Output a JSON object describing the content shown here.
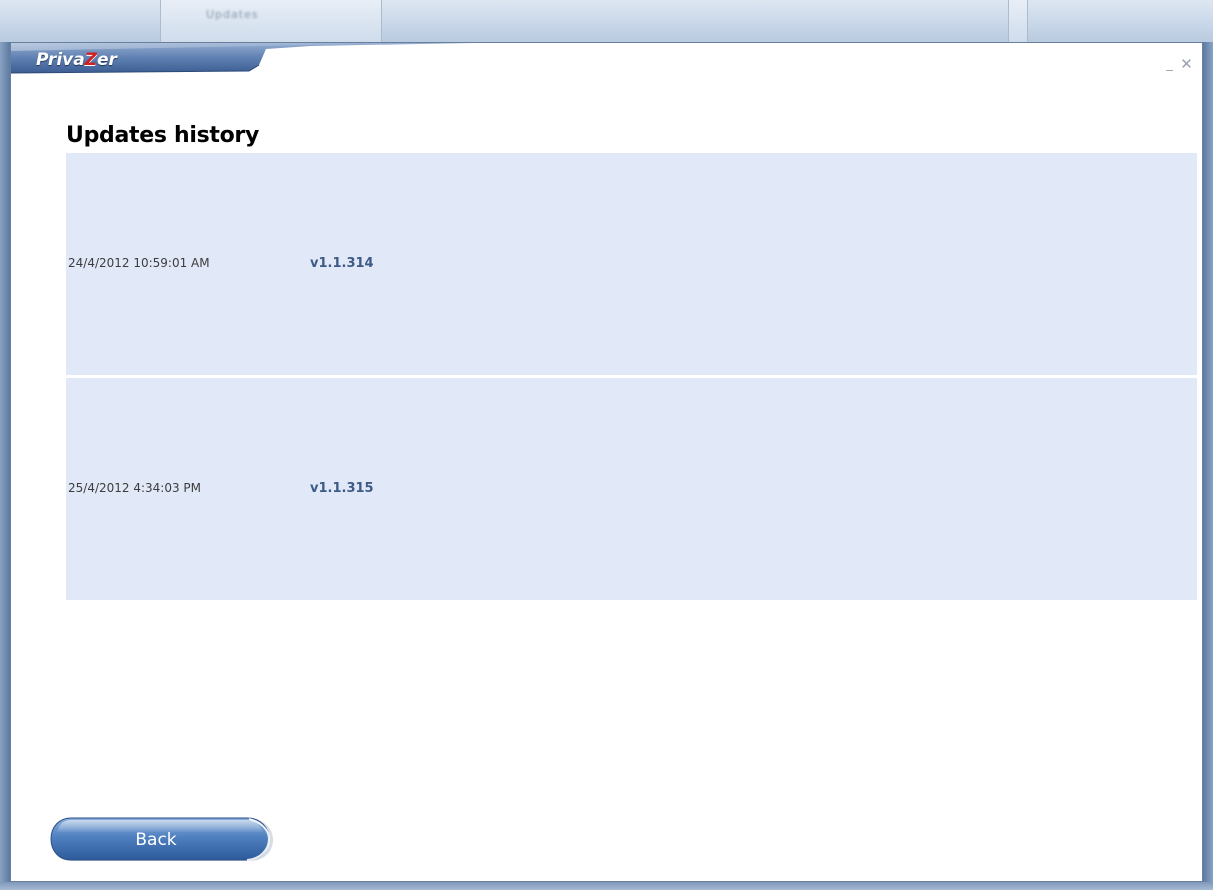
{
  "background_window": {
    "blurred_tab_text": "Updates"
  },
  "app": {
    "logo": {
      "part1": "Priva",
      "part2": "Z",
      "part3": "er"
    },
    "controls": {
      "minimize_glyph": "_",
      "close_glyph": "✕"
    }
  },
  "main": {
    "title": "Updates history",
    "history": [
      {
        "date": "24/4/2012 10:59:01 AM",
        "version": "v1.1.314"
      },
      {
        "date": "25/4/2012 4:34:03 PM",
        "version": "v1.1.315"
      }
    ]
  },
  "footer": {
    "back_label": "Back"
  },
  "colors": {
    "row_background": "#e1e8f7",
    "version_text": "#3e5a86",
    "logo_z": "#d21f1f",
    "button_blue": "#3f72b5"
  }
}
